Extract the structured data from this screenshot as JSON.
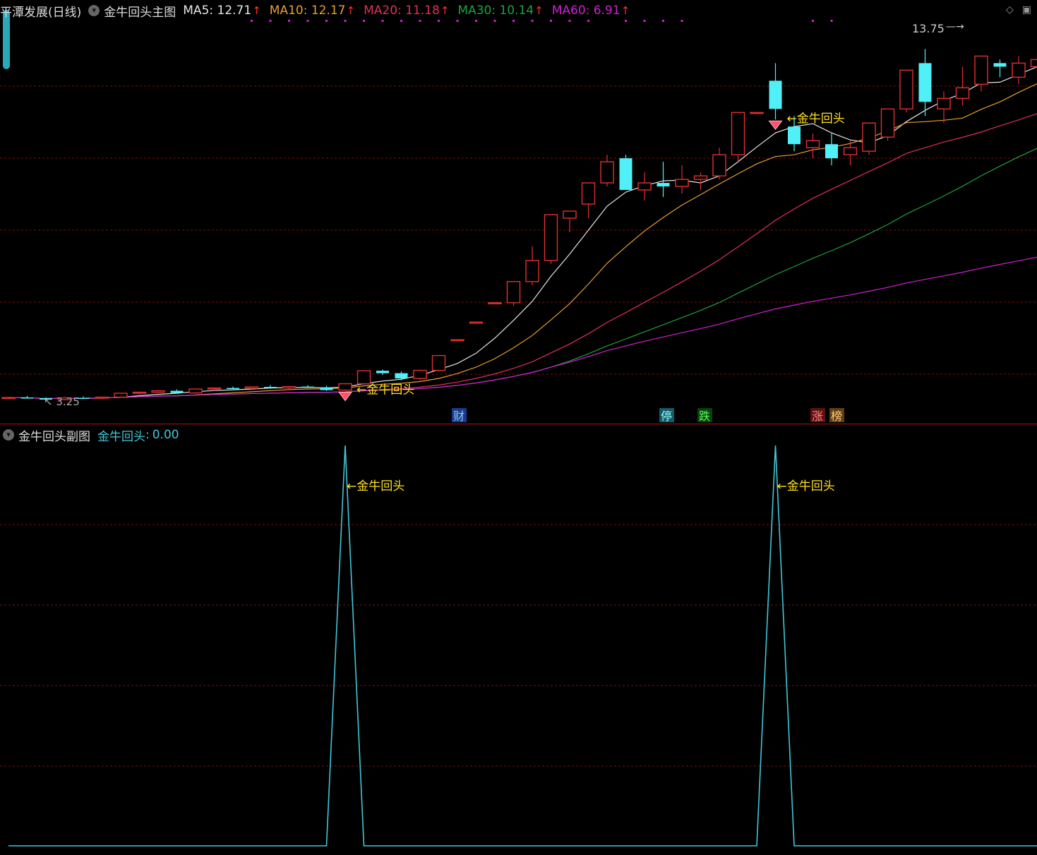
{
  "main_panel": {
    "stock_name": "平潭发展(日线)",
    "indicator_name": "金牛回头主图",
    "ma": [
      {
        "label": "MA5",
        "value": "12.71",
        "color": "#e6e6e6"
      },
      {
        "label": "MA10",
        "value": "12.17",
        "color": "#e8a030"
      },
      {
        "label": "MA20",
        "value": "11.18",
        "color": "#e0305a"
      },
      {
        "label": "MA30",
        "value": "10.14",
        "color": "#20a040"
      },
      {
        "label": "MA60",
        "value": "6.91",
        "color": "#d020d0"
      }
    ],
    "high_label": "13.75",
    "low_label": "3.25",
    "signal_label": "金牛回头",
    "event_tags": [
      {
        "text": "财",
        "bg": "#1a3a8a",
        "fg": "#8ec8ff"
      },
      {
        "text": "停",
        "bg": "#145a6a",
        "fg": "#9ff"
      },
      {
        "text": "跌",
        "bg": "#0a4010",
        "fg": "#5f5"
      },
      {
        "text": "涨",
        "bg": "#601010",
        "fg": "#f88"
      },
      {
        "text": "榜",
        "bg": "#604010",
        "fg": "#fc8"
      }
    ],
    "icons": [
      "diamond-icon",
      "window-icon",
      "collapse-icon"
    ]
  },
  "sub_panel": {
    "indicator_name": "金牛回头副图",
    "series_label": "金牛回头",
    "series_value": "0.00",
    "series_color": "#40c8d8",
    "signal_label": "←金牛回头"
  },
  "colors": {
    "up": "#e03030",
    "down": "#50f0f8",
    "grid": "#7a1010"
  },
  "chart_data": [
    {
      "type": "candlestick",
      "title": "金牛回头主图",
      "ylim": [
        3.25,
        13.75
      ],
      "candles": [
        [
          3.3,
          3.32,
          3.28,
          3.31
        ],
        [
          3.31,
          3.35,
          3.28,
          3.29
        ],
        [
          3.29,
          3.31,
          3.22,
          3.25
        ],
        [
          3.25,
          3.32,
          3.24,
          3.3
        ],
        [
          3.3,
          3.34,
          3.28,
          3.29
        ],
        [
          3.29,
          3.33,
          3.27,
          3.32
        ],
        [
          3.32,
          3.44,
          3.3,
          3.43
        ],
        [
          3.43,
          3.48,
          3.4,
          3.46
        ],
        [
          3.46,
          3.52,
          3.44,
          3.5
        ],
        [
          3.5,
          3.54,
          3.42,
          3.44
        ],
        [
          3.44,
          3.56,
          3.42,
          3.55
        ],
        [
          3.55,
          3.6,
          3.5,
          3.58
        ],
        [
          3.58,
          3.62,
          3.55,
          3.57
        ],
        [
          3.57,
          3.62,
          3.54,
          3.61
        ],
        [
          3.61,
          3.66,
          3.56,
          3.58
        ],
        [
          3.58,
          3.64,
          3.55,
          3.62
        ],
        [
          3.62,
          3.66,
          3.58,
          3.6
        ],
        [
          3.6,
          3.64,
          3.5,
          3.52
        ],
        [
          3.52,
          3.7,
          3.5,
          3.7
        ],
        [
          3.7,
          4.07,
          3.68,
          4.07
        ],
        [
          4.07,
          4.1,
          3.95,
          4.0
        ],
        [
          4.0,
          4.05,
          3.8,
          3.85
        ],
        [
          3.85,
          4.1,
          3.8,
          4.08
        ],
        [
          4.08,
          4.5,
          4.05,
          4.5
        ],
        [
          4.95,
          4.95,
          4.95,
          4.95
        ],
        [
          5.45,
          5.45,
          5.45,
          5.45
        ],
        [
          6.0,
          6.0,
          6.0,
          6.0
        ],
        [
          6.0,
          6.6,
          5.9,
          6.6
        ],
        [
          6.6,
          7.6,
          6.5,
          7.2
        ],
        [
          7.2,
          8.2,
          7.1,
          8.5
        ],
        [
          8.4,
          8.5,
          8.0,
          8.6
        ],
        [
          8.8,
          9.4,
          8.4,
          9.4
        ],
        [
          9.4,
          10.2,
          9.3,
          10.0
        ],
        [
          10.1,
          10.2,
          9.4,
          9.2
        ],
        [
          9.2,
          9.7,
          8.9,
          9.4
        ],
        [
          9.4,
          10.0,
          9.0,
          9.3
        ],
        [
          9.3,
          9.9,
          9.1,
          9.5
        ],
        [
          9.5,
          9.7,
          9.2,
          9.6
        ],
        [
          9.6,
          10.4,
          9.5,
          10.2
        ],
        [
          10.2,
          11.3,
          10.0,
          11.4
        ],
        [
          11.4,
          11.4,
          11.4,
          11.4
        ],
        [
          12.3,
          12.8,
          11.2,
          11.5
        ],
        [
          11.0,
          11.3,
          10.3,
          10.5
        ],
        [
          10.4,
          10.8,
          10.1,
          10.6
        ],
        [
          10.5,
          10.8,
          9.9,
          10.1
        ],
        [
          10.2,
          10.6,
          9.9,
          10.4
        ],
        [
          10.3,
          11.0,
          10.2,
          11.1
        ],
        [
          10.7,
          11.4,
          10.6,
          11.5
        ],
        [
          11.5,
          12.6,
          11.4,
          12.6
        ],
        [
          12.8,
          13.2,
          11.3,
          11.7
        ],
        [
          11.5,
          12.0,
          11.1,
          11.8
        ],
        [
          11.8,
          12.7,
          11.6,
          12.1
        ],
        [
          12.2,
          12.7,
          12.0,
          13.0
        ],
        [
          12.8,
          12.9,
          12.4,
          12.7
        ],
        [
          12.4,
          13.0,
          12.2,
          12.8
        ],
        [
          12.7,
          13.1,
          12.4,
          12.9
        ],
        [
          12.8,
          13.2,
          12.6,
          13.0
        ],
        [
          13.0,
          13.75,
          12.9,
          13.6
        ]
      ],
      "signals": [
        18,
        41
      ]
    },
    {
      "type": "line",
      "title": "金牛回头副图",
      "series": [
        {
          "name": "金牛回头",
          "values": [
            0,
            0,
            0,
            0,
            0,
            0,
            0,
            0,
            0,
            0,
            0,
            0,
            0,
            0,
            0,
            0,
            0,
            0,
            1,
            0,
            0,
            0,
            0,
            0,
            0,
            0,
            0,
            0,
            0,
            0,
            0,
            0,
            0,
            0,
            0,
            0,
            0,
            0,
            0,
            0,
            0,
            1,
            0,
            0,
            0,
            0,
            0,
            0,
            0,
            0,
            0,
            0,
            0,
            0,
            0,
            0,
            0,
            0
          ]
        }
      ],
      "ylim": [
        0,
        1
      ]
    }
  ]
}
